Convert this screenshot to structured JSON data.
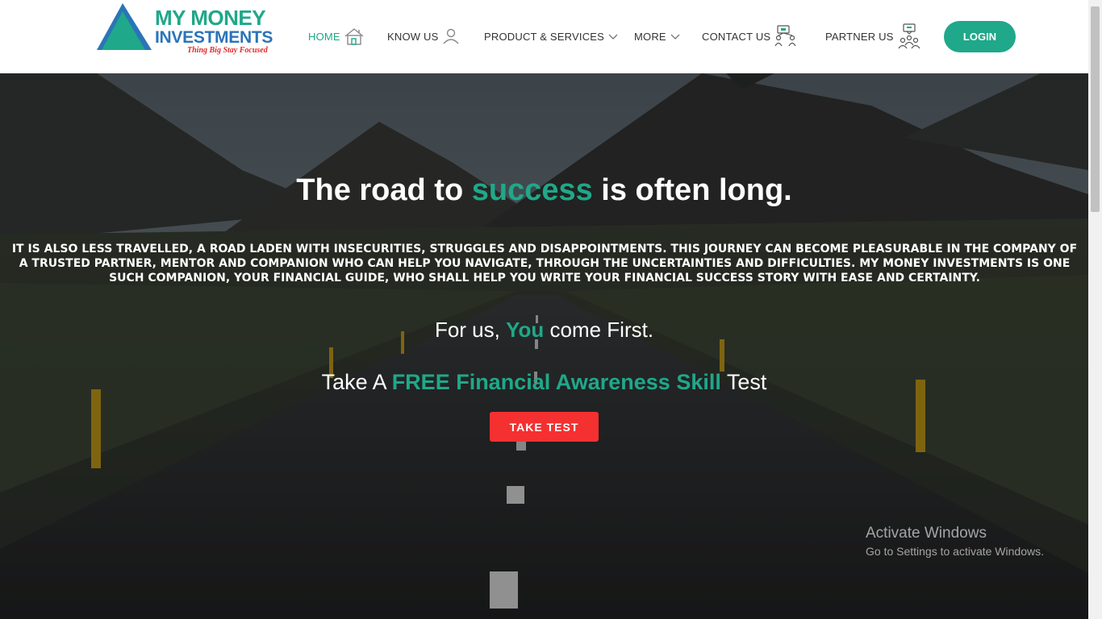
{
  "header": {
    "logo": {
      "line1": "MY MONEY",
      "line2": "INVESTMENTS",
      "tagline": "Thing Big Stay Focused",
      "icon": "triangle-logo-icon"
    },
    "nav": [
      {
        "label": "HOME",
        "icon": "home-icon",
        "active": true
      },
      {
        "label": "KNOW US",
        "icon": "user-icon"
      },
      {
        "label": "PRODUCT & SERVICES",
        "icon": "chevron-down-icon"
      },
      {
        "label": "MORE",
        "icon": "chevron-down-icon"
      },
      {
        "label": "CONTACT US",
        "icon": "contact-network-icon"
      },
      {
        "label": "PARTNER US",
        "icon": "partner-group-icon"
      }
    ],
    "login_label": "LOGIN"
  },
  "hero": {
    "title_pre": "The road to ",
    "title_accent": "success",
    "title_post": " is often long.",
    "description": "IT IS ALSO LESS TRAVELLED, A ROAD LADEN WITH INSECURITIES, STRUGGLES AND DISAPPOINTMENTS. THIS JOURNEY CAN BECOME PLEASURABLE IN THE COMPANY OF A TRUSTED PARTNER, MENTOR AND COMPANION WHO CAN HELP YOU NAVIGATE, THROUGH THE UNCERTAINTIES AND DIFFICULTIES. MY MONEY INVESTMENTS IS ONE SUCH COMPANION, YOUR FINANCIAL GUIDE, WHO SHALL HELP YOU WRITE YOUR FINANCIAL SUCCESS STORY WITH EASE AND CERTAINTY.",
    "tagline_pre": "For us, ",
    "tagline_accent": "You",
    "tagline_post": " come First.",
    "test_pre": "Take A ",
    "test_accent": "FREE Financial Awareness Skill",
    "test_post": " Test",
    "button_label": "TAKE TEST"
  },
  "watermark": {
    "line1": "Activate Windows",
    "line2": "Go to Settings to activate Windows."
  },
  "colors": {
    "brand_green": "#1fa889",
    "brand_blue": "#2b74b8",
    "cta_red": "#f43030",
    "tagline_red": "#e02a2a"
  }
}
